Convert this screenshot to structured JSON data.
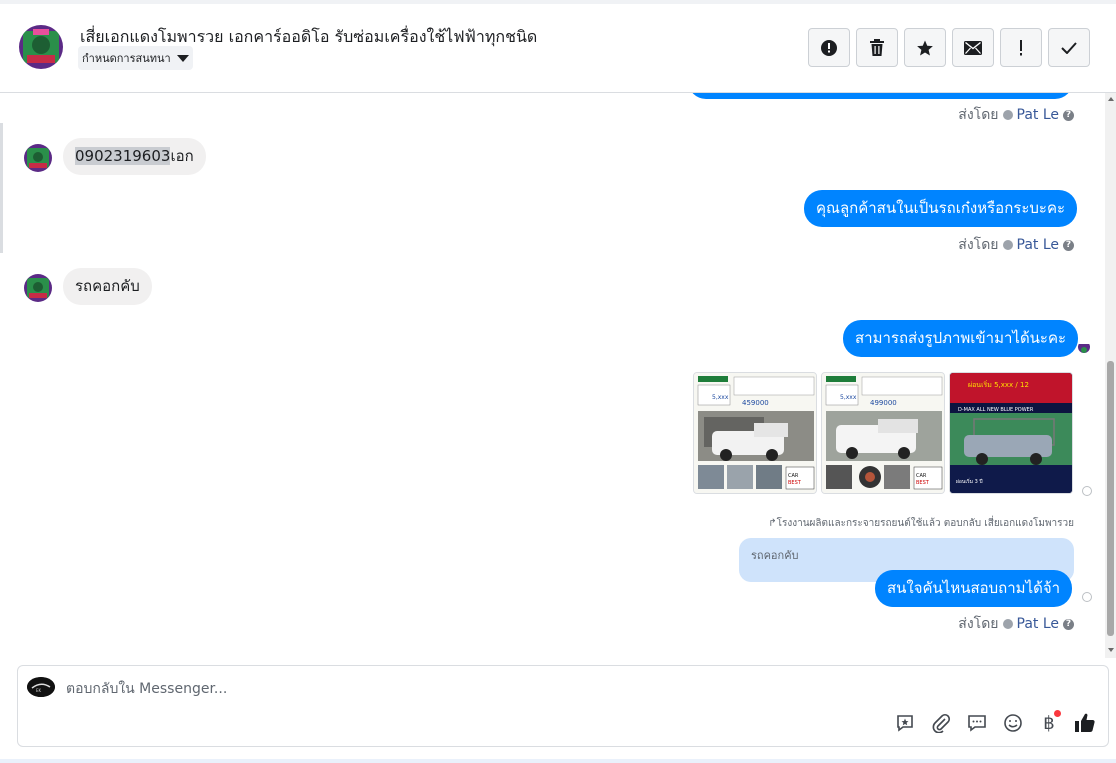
{
  "header": {
    "title": "เสี่ยเอกแดงโมพารวย เอกคาร์ออดิโอ รับซ่อมเครื่องใช้ไฟฟ้าทุกชนิด",
    "assign_label": "กำหนดการสนทนา",
    "actions": [
      {
        "name": "report-button",
        "icon": "alert-circle-icon"
      },
      {
        "name": "delete-button",
        "icon": "trash-icon"
      },
      {
        "name": "star-button",
        "icon": "star-icon"
      },
      {
        "name": "mark-unread-button",
        "icon": "envelope-icon"
      },
      {
        "name": "spam-button",
        "icon": "exclamation-icon"
      },
      {
        "name": "done-button",
        "icon": "check-icon"
      }
    ]
  },
  "messages": {
    "sent_by_label": "ส่งโดย",
    "agent_name": "Pat Le",
    "in1_highlight": "0902319603",
    "in1_rest": "เอก",
    "out1": "คุณลูกค้าสนในเป็นรถเก๋งหรือกระบะคะ",
    "in2": "รถคอกคับ",
    "out2": "สามารถส่งรูปภาพเข้ามาได้นะคะ",
    "photos": [
      {
        "price": "459000",
        "tag": "CAR BEST DEALER"
      },
      {
        "price": "499000",
        "tag": "CAR BEST DEALER"
      },
      {
        "headline": "ผ่อนเริ่ม 5,xxx / 12 เดือนแรก",
        "sub": "D-MAX ALL NEW BLUE POWER SPARK 1.9 B DI S MT 2019"
      }
    ],
    "reply_note": "โรงงานผลิตและกระจายรถยนต์ใช้แล้ว ตอบกลับ เสี่ยเอกแดงโมพารวย",
    "quoted": "รถคอกคับ",
    "out3": "สนใจคันไหนสอบถามได้จ้า"
  },
  "composer": {
    "placeholder": "ตอบกลับใน Messenger...",
    "baht_symbol": "฿"
  },
  "colors": {
    "accent": "#0084ff",
    "incoming": "#f1f0f0",
    "quoted": "#cfe3fb"
  }
}
